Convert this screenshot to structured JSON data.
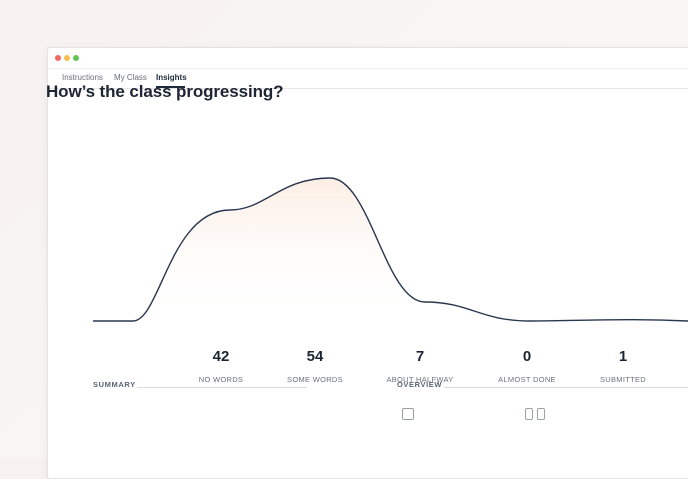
{
  "tabs": [
    {
      "label": "Instructions",
      "active": false
    },
    {
      "label": "My Class",
      "active": false
    },
    {
      "label": "Insights",
      "active": true
    }
  ],
  "headline": "How’s the class progressing?",
  "stats": [
    {
      "value": "42",
      "label": "NO WORDS"
    },
    {
      "value": "54",
      "label": "SOME WORDS"
    },
    {
      "value": "7",
      "label": "ABOUT HALFWAY"
    },
    {
      "value": "0",
      "label": "ALMOST DONE"
    },
    {
      "value": "1",
      "label": "SUBMITTED"
    }
  ],
  "sections": {
    "summary": "SUMMARY",
    "overview": "OVERVIEW"
  },
  "colors": {
    "curve": "#2a3650",
    "fill": "#fbefe6",
    "accent": "#1f2a3c"
  }
}
